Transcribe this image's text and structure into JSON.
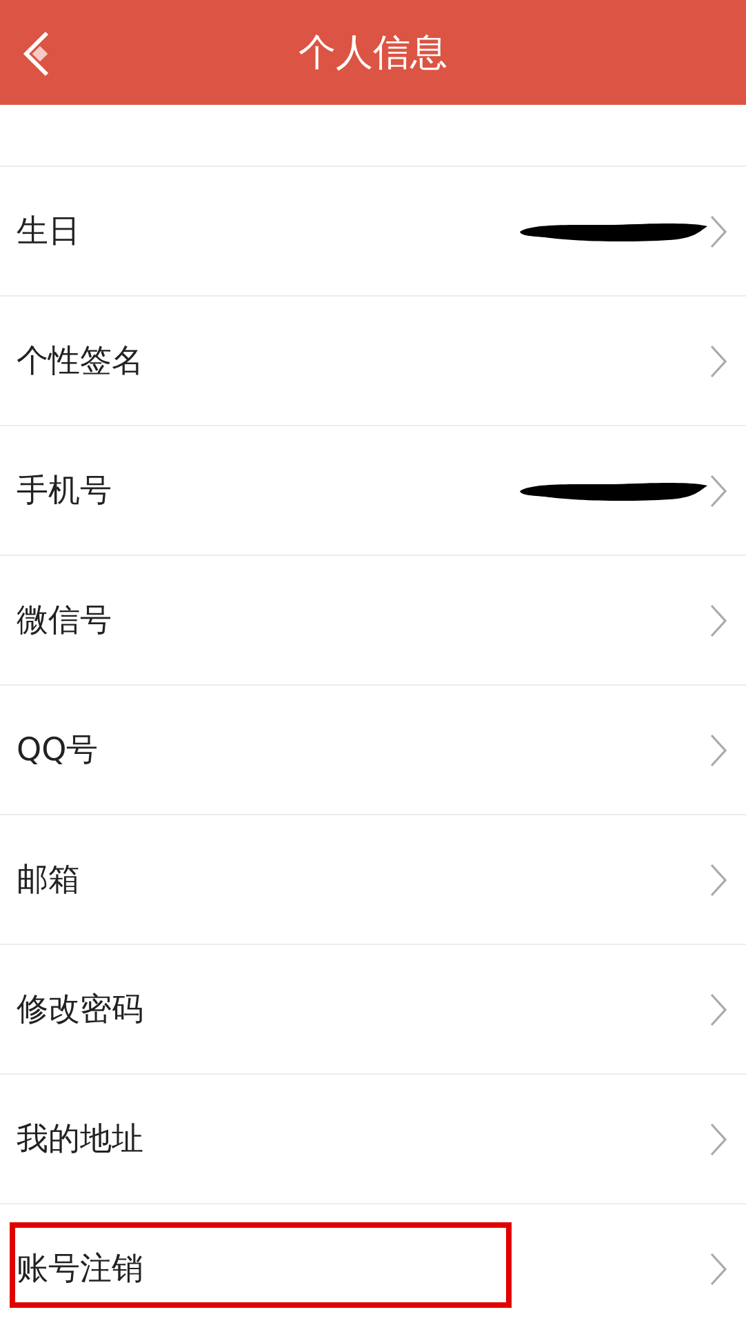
{
  "header": {
    "title": "个人信息"
  },
  "rows": [
    {
      "label": "生日",
      "redacted": true,
      "highlighted": false
    },
    {
      "label": "个性签名",
      "redacted": false,
      "highlighted": false
    },
    {
      "label": "手机号",
      "redacted": true,
      "highlighted": false
    },
    {
      "label": "微信号",
      "redacted": false,
      "highlighted": false
    },
    {
      "label": "QQ号",
      "redacted": false,
      "highlighted": false
    },
    {
      "label": "邮箱",
      "redacted": false,
      "highlighted": false
    },
    {
      "label": "修改密码",
      "redacted": false,
      "highlighted": false
    },
    {
      "label": "我的地址",
      "redacted": false,
      "highlighted": false
    },
    {
      "label": "账号注销",
      "redacted": false,
      "highlighted": true
    }
  ]
}
